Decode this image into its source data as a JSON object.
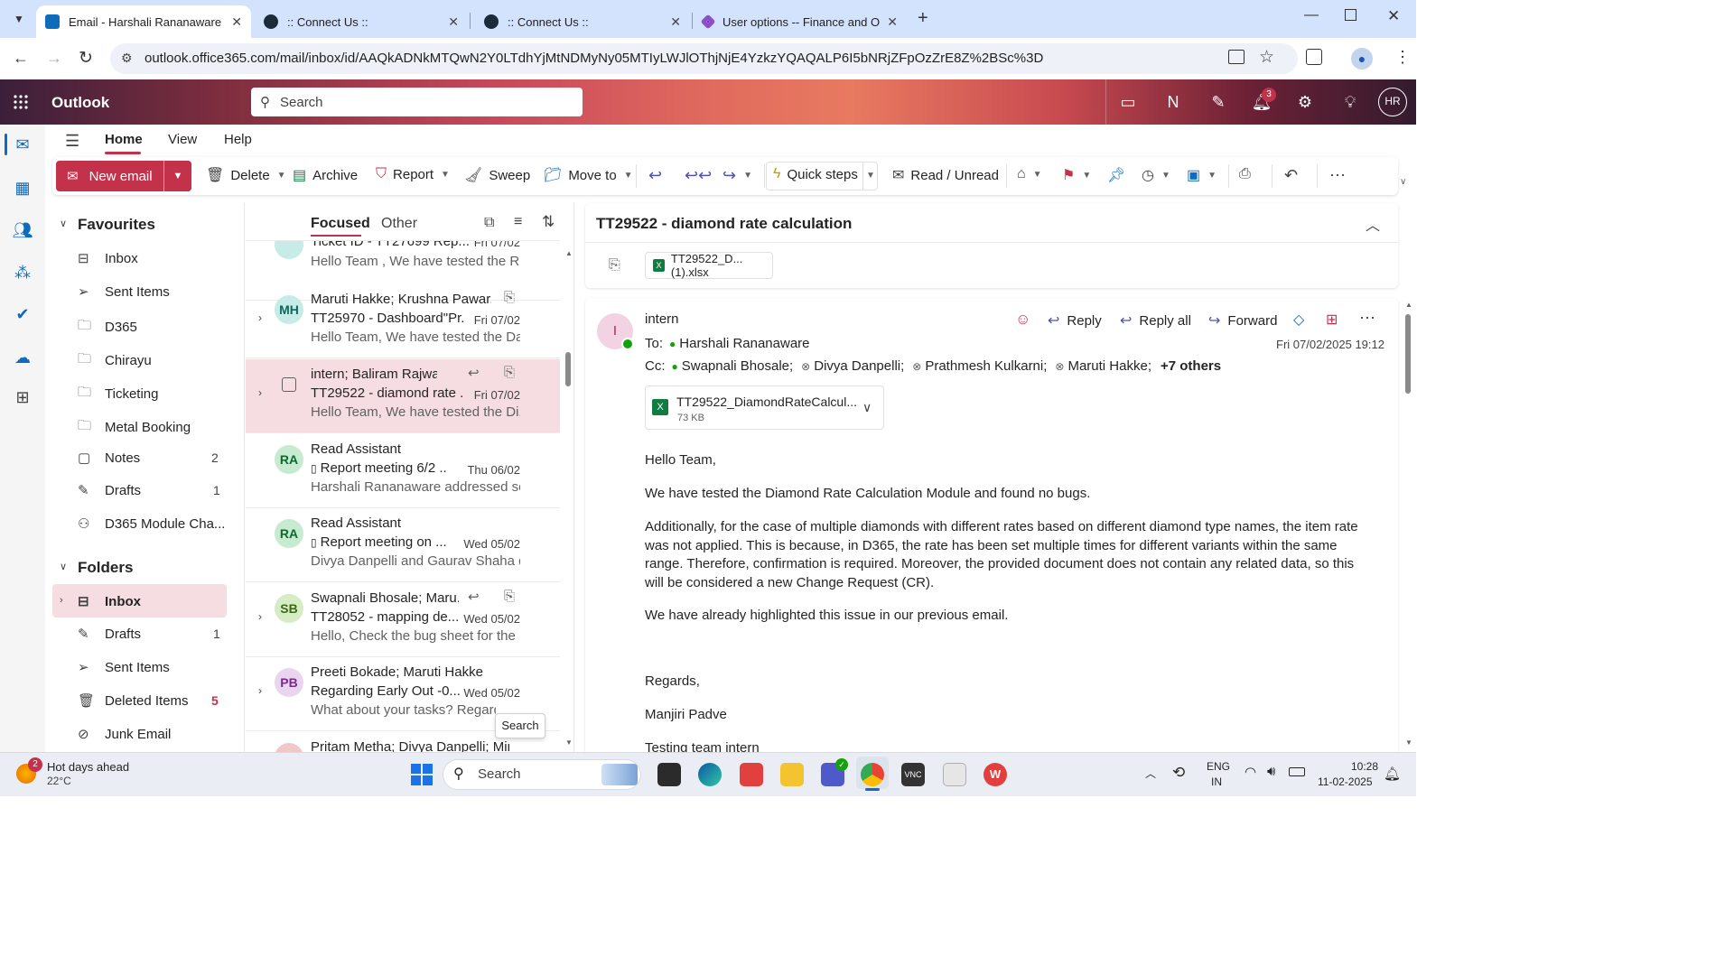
{
  "browser": {
    "tabs": [
      {
        "title": "Email - Harshali Rananaware - O",
        "active": true
      },
      {
        "title": ":: Connect Us ::",
        "active": false
      },
      {
        "title": ":: Connect Us ::",
        "active": false
      },
      {
        "title": "User options -- Finance and Op",
        "active": false
      }
    ],
    "url": "outlook.office365.com/mail/inbox/id/AAQkADNkMTQwN2Y0LTdhYjMtNDMyNy05MTIyLWJlOThjNjE4YzkzYQAQALP6I5bNRjZFpOzZrE8Z%2BSc%3D"
  },
  "outlook": {
    "app_name": "Outlook",
    "search_placeholder": "Search",
    "notification_count": "3",
    "user_initials": "HR",
    "ribbon_tabs": [
      "Home",
      "View",
      "Help"
    ],
    "ribbon": {
      "new_email": "New email",
      "delete": "Delete",
      "archive": "Archive",
      "report": "Report",
      "sweep": "Sweep",
      "move_to": "Move to",
      "quick_steps": "Quick steps",
      "read_unread": "Read / Unread"
    }
  },
  "folders": {
    "favourites_label": "Favourites",
    "favourites": [
      {
        "name": "Inbox",
        "icon": "inbox-icon",
        "count": ""
      },
      {
        "name": "Sent Items",
        "icon": "send-icon",
        "count": ""
      },
      {
        "name": "D365",
        "icon": "folder-icon",
        "count": ""
      },
      {
        "name": "Chirayu",
        "icon": "folder-icon",
        "count": ""
      },
      {
        "name": "Ticketing",
        "icon": "folder-icon",
        "count": ""
      },
      {
        "name": "Metal Booking",
        "icon": "folder-icon",
        "count": ""
      },
      {
        "name": "Notes",
        "icon": "note-icon",
        "count": "2"
      },
      {
        "name": "Drafts",
        "icon": "pencil-icon",
        "count": "1"
      },
      {
        "name": "D365 Module Cha...",
        "icon": "group-icon",
        "count": ""
      }
    ],
    "folders_label": "Folders",
    "folders": [
      {
        "name": "Inbox",
        "icon": "inbox-icon",
        "count": ""
      },
      {
        "name": "Drafts",
        "icon": "pencil-icon",
        "count": "1"
      },
      {
        "name": "Sent Items",
        "icon": "send-icon",
        "count": ""
      },
      {
        "name": "Deleted Items",
        "icon": "trash-icon",
        "count": "5"
      },
      {
        "name": "Junk Email",
        "icon": "junk-icon",
        "count": ""
      }
    ]
  },
  "message_list": {
    "tab_focused": "Focused",
    "tab_other": "Other",
    "messages": [
      {
        "initials": "",
        "from": "Ticket ID - TT27699 Rep...",
        "subject": "",
        "date": "Fri 07/02",
        "preview": "Hello Team , We have tested the R..."
      },
      {
        "initials": "MH",
        "from": "Maruti Hakke; Krushna Pawar...",
        "subject": "TT25970 - Dashboard\"Pr...",
        "date": "Fri 07/02",
        "preview": "Hello Team, We have tested the Da..."
      },
      {
        "initials": "",
        "from": "intern; Baliram Rajwad; ...",
        "subject": "TT29522 - diamond rate ...",
        "date": "Fri 07/02",
        "preview": "Hello Team, We have tested the Di..."
      },
      {
        "initials": "RA",
        "from": "Read Assistant",
        "subject": "Report meeting 6/2 ...",
        "date": "Thu 06/02",
        "preview": "Harshali Rananaware addressed se..."
      },
      {
        "initials": "RA",
        "from": "Read Assistant",
        "subject": "Report meeting on ...",
        "date": "Wed 05/02",
        "preview": "Divya Danpelli and Gaurav Shaha d..."
      },
      {
        "initials": "SB",
        "from": "Swapnali Bhosale; Maru...",
        "subject": "TT28052 - mapping de...",
        "date": "Wed 05/02",
        "preview": "Hello, Check the bug sheet for the ..."
      },
      {
        "initials": "PB",
        "from": "Preeti Bokade; Maruti Hakke",
        "subject": "Regarding Early Out -0...",
        "date": "Wed 05/02",
        "preview": "What about your tasks? Regards  R"
      },
      {
        "initials": "",
        "from": "Pritam Metha; Divya Danpelli; Min...",
        "subject": "",
        "date": "",
        "preview": ""
      }
    ],
    "tooltip": "Search"
  },
  "reading": {
    "subject": "TT29522 - diamond rate calculation",
    "top_attachment": "TT29522_D...(1).xlsx",
    "sender_initial": "I",
    "sender": "intern",
    "to_label": "To:",
    "to": "Harshali Rananaware",
    "cc_label": "Cc:",
    "cc": [
      "Swapnali Bhosale;",
      "Divya Danpelli;",
      "Prathmesh Kulkarni;",
      "Maruti Hakke;"
    ],
    "cc_more": "+7 others",
    "reply": "Reply",
    "reply_all": "Reply all",
    "forward": "Forward",
    "datetime": "Fri 07/02/2025 19:12",
    "attachment_name": "TT29522_DiamondRateCalcul...",
    "attachment_size": "73 KB",
    "body": [
      "Hello Team,",
      "We have tested the Diamond Rate Calculation Module and found no bugs.",
      "Additionally, for the case of multiple diamonds with different rates based on different diamond type names, the item rate was not applied. This is because, in D365, the rate has been set multiple times for different variants within the same range. Therefore, confirmation is required. Moreover, the provided document does not contain any related data, so this will be considered a new Change Request (CR).",
      "We have already highlighted this issue in our previous email.",
      "Regards,",
      "Manjiri Padve",
      "Testing team intern"
    ]
  },
  "taskbar": {
    "weather_title": "Hot days ahead",
    "weather_temp": "22°C",
    "weather_badge": "2",
    "search": "Search",
    "lang1": "ENG",
    "lang2": "IN",
    "time": "10:28",
    "date": "11-02-2025"
  }
}
